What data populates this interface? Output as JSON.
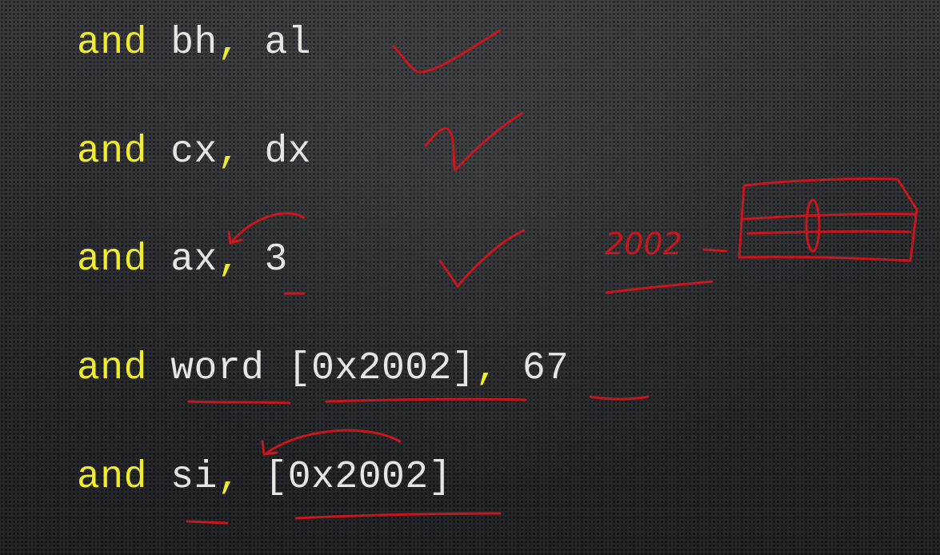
{
  "code_lines": [
    {
      "mnemonic": "and",
      "dest": "bh",
      "comma": ",",
      "src": "al"
    },
    {
      "mnemonic": "and",
      "dest": "cx",
      "comma": ",",
      "src": "dx"
    },
    {
      "mnemonic": "and",
      "dest": "ax",
      "comma": ",",
      "src": "3"
    },
    {
      "mnemonic": "and",
      "size": "word",
      "dest": "[0x2002]",
      "comma": ",",
      "src": "67"
    },
    {
      "mnemonic": "and",
      "dest": "si",
      "comma": ",",
      "src": "[0x2002]"
    }
  ],
  "annotations": {
    "memory_address": "2002",
    "memory_value": "0"
  },
  "colors": {
    "keyword": "#f1ec2e",
    "operand": "#e6e6e6",
    "ink": "#c8161d"
  }
}
